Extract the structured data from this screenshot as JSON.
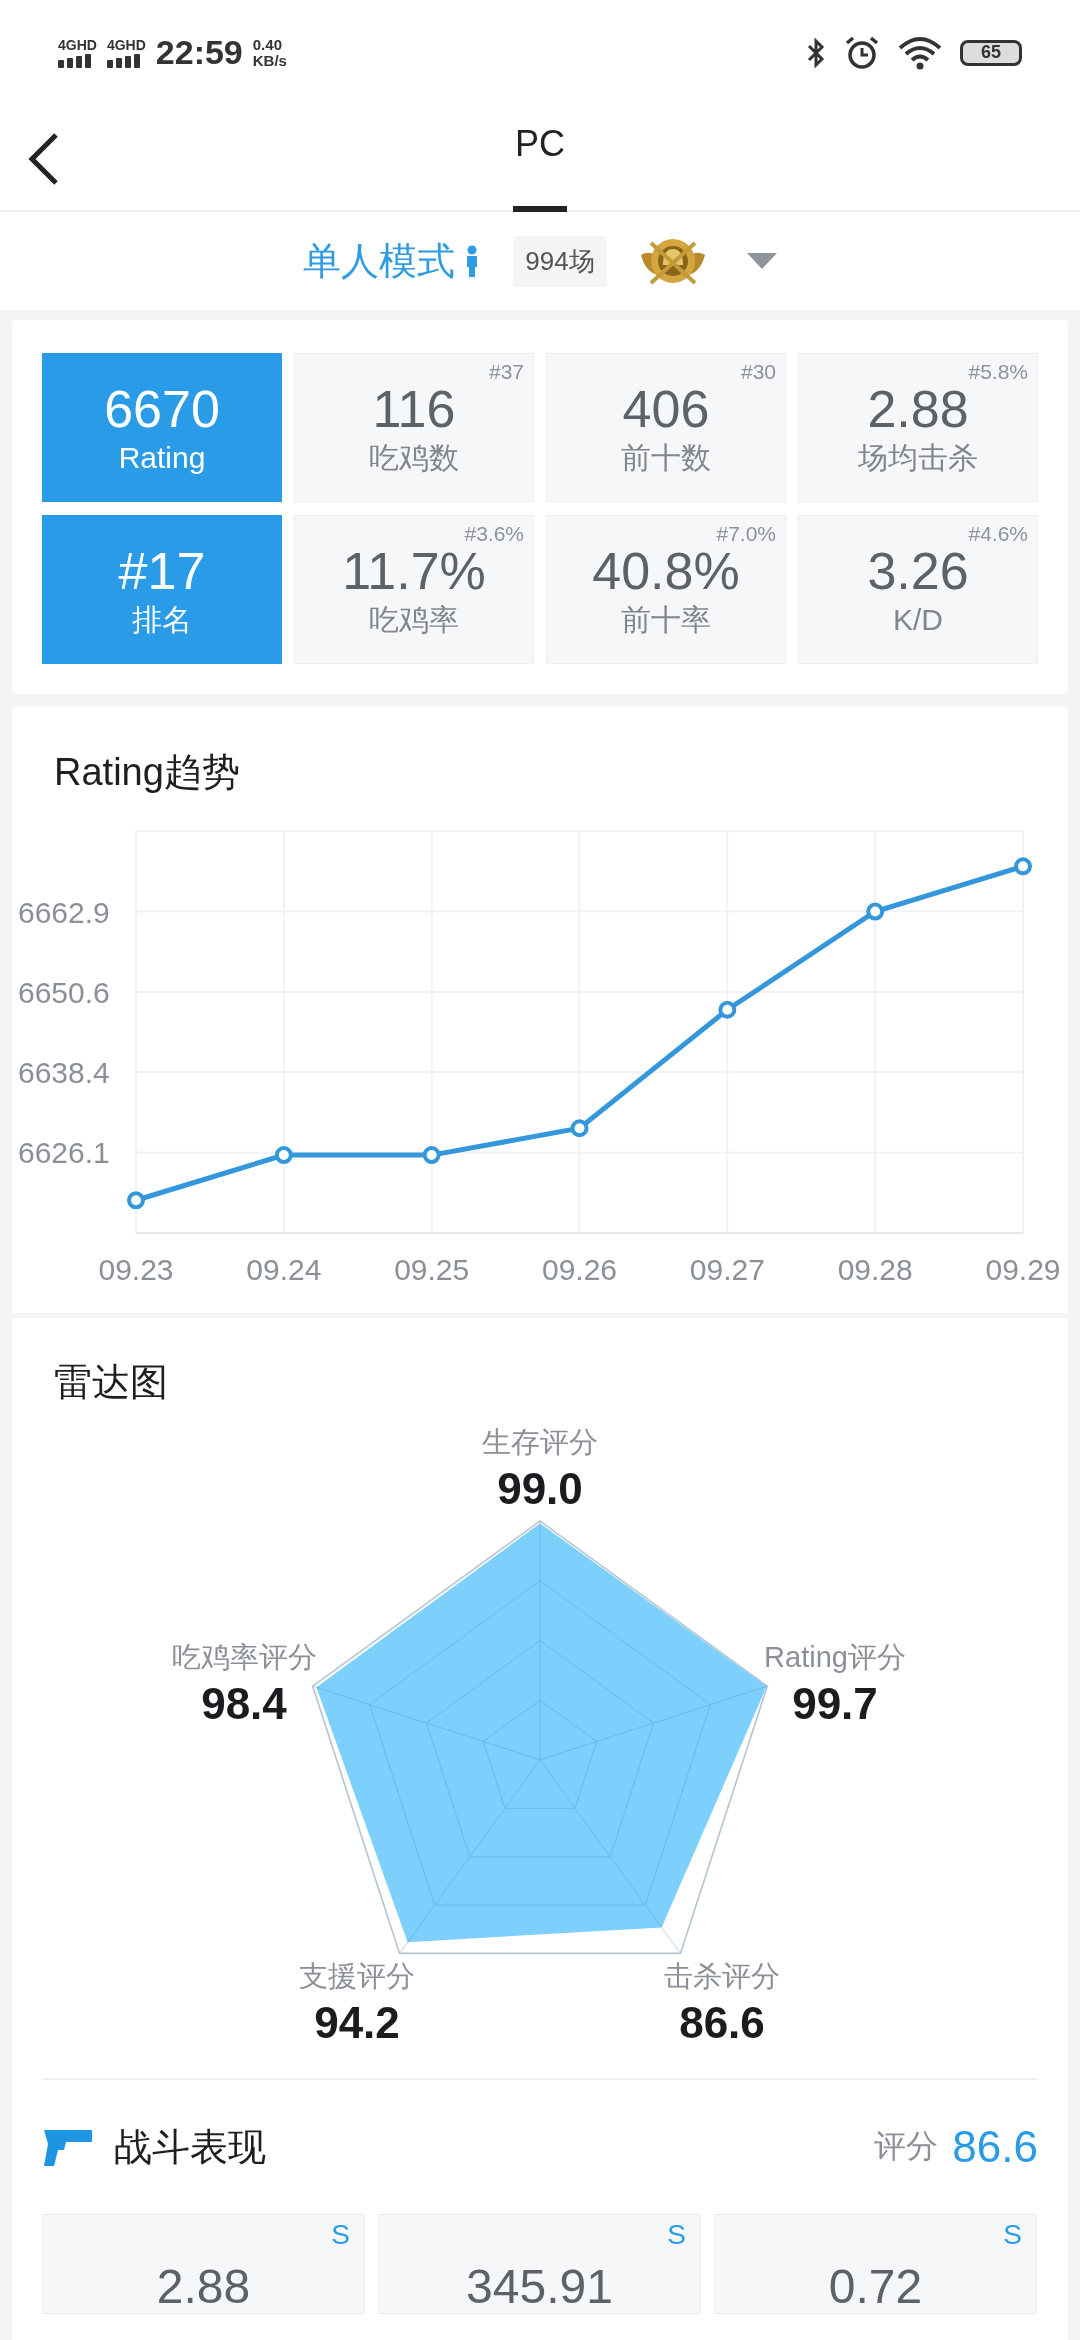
{
  "status_bar": {
    "network_1": "4GHD",
    "network_2": "4GHD",
    "time": "22:59",
    "speed": "0.40",
    "speed_unit": "KB/s",
    "battery": "65"
  },
  "header": {
    "tabs": [
      {
        "label": "PC",
        "selected": true
      }
    ]
  },
  "mode_selector": {
    "mode": "单人模式",
    "matches": "994场"
  },
  "stats": [
    {
      "kind": "highlight",
      "value": "6670",
      "label": "Rating"
    },
    {
      "kind": "stat",
      "value": "116",
      "label": "吃鸡数",
      "rank": "#37"
    },
    {
      "kind": "stat",
      "value": "406",
      "label": "前十数",
      "rank": "#30"
    },
    {
      "kind": "stat",
      "value": "2.88",
      "label": "场均击杀",
      "rank": "#5.8%"
    },
    {
      "kind": "highlight",
      "value": "#17",
      "label": "排名"
    },
    {
      "kind": "stat",
      "value": "11.7%",
      "label": "吃鸡率",
      "rank": "#3.6%"
    },
    {
      "kind": "stat",
      "value": "40.8%",
      "label": "前十率",
      "rank": "#7.0%"
    },
    {
      "kind": "stat",
      "value": "3.26",
      "label": "K/D",
      "rank": "#4.6%"
    }
  ],
  "trend": {
    "title": "Rating趋势",
    "chart_data": {
      "type": "line",
      "categories": [
        "09.23",
        "09.24",
        "09.25",
        "09.26",
        "09.27",
        "09.28",
        "09.29"
      ],
      "series": [
        {
          "color": "#3497db",
          "marker": "circle",
          "values": [
            6618.8,
            6625.7,
            6625.7,
            6629.8,
            6647.9,
            6662.9,
            6669.8
          ]
        }
      ],
      "ylim": [
        6613.8,
        6675.2
      ],
      "yticks": [
        6626.1,
        6638.4,
        6650.6,
        6662.9
      ],
      "grid": true
    }
  },
  "radar": {
    "title": "雷达图",
    "axes": [
      {
        "label": "生存评分",
        "value": "99.0"
      },
      {
        "label": "吃鸡率评分",
        "value": "98.4"
      },
      {
        "label": "Rating评分",
        "value": "99.7"
      },
      {
        "label": "支援评分",
        "value": "94.2"
      },
      {
        "label": "击杀评分",
        "value": "86.6"
      }
    ]
  },
  "combat": {
    "title": "战斗表现",
    "score_label": "评分",
    "score": "86.6",
    "cards": [
      {
        "grade": "S",
        "value": "2.88"
      },
      {
        "grade": "S",
        "value": "345.91"
      },
      {
        "grade": "S",
        "value": "0.72"
      }
    ]
  }
}
